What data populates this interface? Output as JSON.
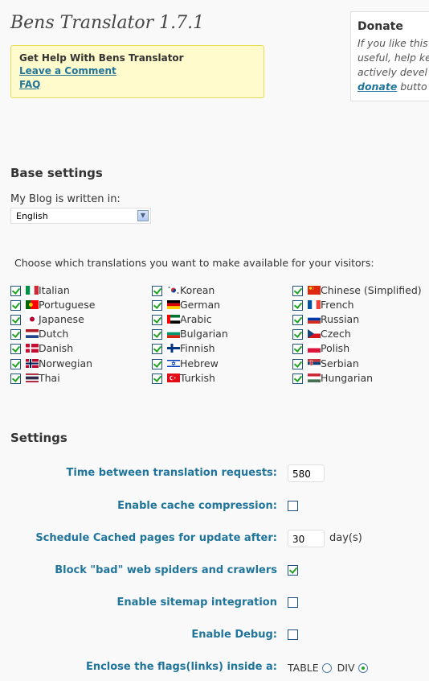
{
  "app_title": "Bens Translator 1.7.1",
  "help_box": {
    "heading": "Get Help With Bens Translator",
    "links": [
      "Leave a Comment",
      "FAQ"
    ]
  },
  "donate_box": {
    "heading": "Donate",
    "line1": "If you like this",
    "line2": "useful, help ke",
    "line3": "actively devel",
    "link": "donate",
    "after_link": " butto"
  },
  "base_settings": {
    "heading": "Base settings",
    "blog_label": "My Blog is written in:",
    "blog_language": "English"
  },
  "translations": {
    "instruction": "Choose which translations you want to make available for your visitors:",
    "languages": [
      {
        "name": "Italian",
        "checked": true,
        "flag": "italy-flag"
      },
      {
        "name": "Korean",
        "checked": true,
        "flag": "korea-flag"
      },
      {
        "name": "Chinese (Simplified)",
        "checked": true,
        "flag": "china-flag"
      },
      {
        "name": "Portuguese",
        "checked": true,
        "flag": "portugal-flag"
      },
      {
        "name": "German",
        "checked": true,
        "flag": "germany-flag"
      },
      {
        "name": "French",
        "checked": true,
        "flag": "france-flag"
      },
      {
        "name": "Japanese",
        "checked": true,
        "flag": "japan-flag"
      },
      {
        "name": "Arabic",
        "checked": true,
        "flag": "uae-flag"
      },
      {
        "name": "Russian",
        "checked": true,
        "flag": "russia-flag"
      },
      {
        "name": "Dutch",
        "checked": true,
        "flag": "netherlands-flag"
      },
      {
        "name": "Bulgarian",
        "checked": true,
        "flag": "bulgaria-flag"
      },
      {
        "name": "Czech",
        "checked": true,
        "flag": "czech-flag"
      },
      {
        "name": "Danish",
        "checked": true,
        "flag": "denmark-flag"
      },
      {
        "name": "Finnish",
        "checked": true,
        "flag": "finland-flag"
      },
      {
        "name": "Polish",
        "checked": true,
        "flag": "poland-flag"
      },
      {
        "name": "Norwegian",
        "checked": true,
        "flag": "norway-flag"
      },
      {
        "name": "Hebrew",
        "checked": true,
        "flag": "israel-flag"
      },
      {
        "name": "Serbian",
        "checked": true,
        "flag": "serbia-flag"
      },
      {
        "name": "Thai",
        "checked": true,
        "flag": "thailand-flag"
      },
      {
        "name": "Turkish",
        "checked": true,
        "flag": "turkey-flag"
      },
      {
        "name": "Hungarian",
        "checked": true,
        "flag": "hungary-flag"
      }
    ]
  },
  "settings": {
    "heading": "Settings",
    "time_between_label": "Time between translation requests:",
    "time_between_value": "580",
    "cache_compression_label": "Enable cache compression:",
    "cache_compression_checked": false,
    "schedule_label": "Schedule Cached pages for update after:",
    "schedule_value": "30",
    "schedule_unit": "day(s)",
    "block_spiders_label": "Block \"bad\" web spiders and crawlers",
    "block_spiders_checked": true,
    "sitemap_label": "Enable sitemap integration",
    "sitemap_checked": false,
    "debug_label": "Enable Debug:",
    "debug_checked": false,
    "enclose_label": "Enclose the flags(links) inside a:",
    "enclose_options": [
      "TABLE",
      "DIV"
    ],
    "enclose_selected": "DIV"
  },
  "colors": {
    "link": "#21759b",
    "help_bg": "#fffbcc",
    "help_border": "#e6db55",
    "check": "#21a121"
  }
}
